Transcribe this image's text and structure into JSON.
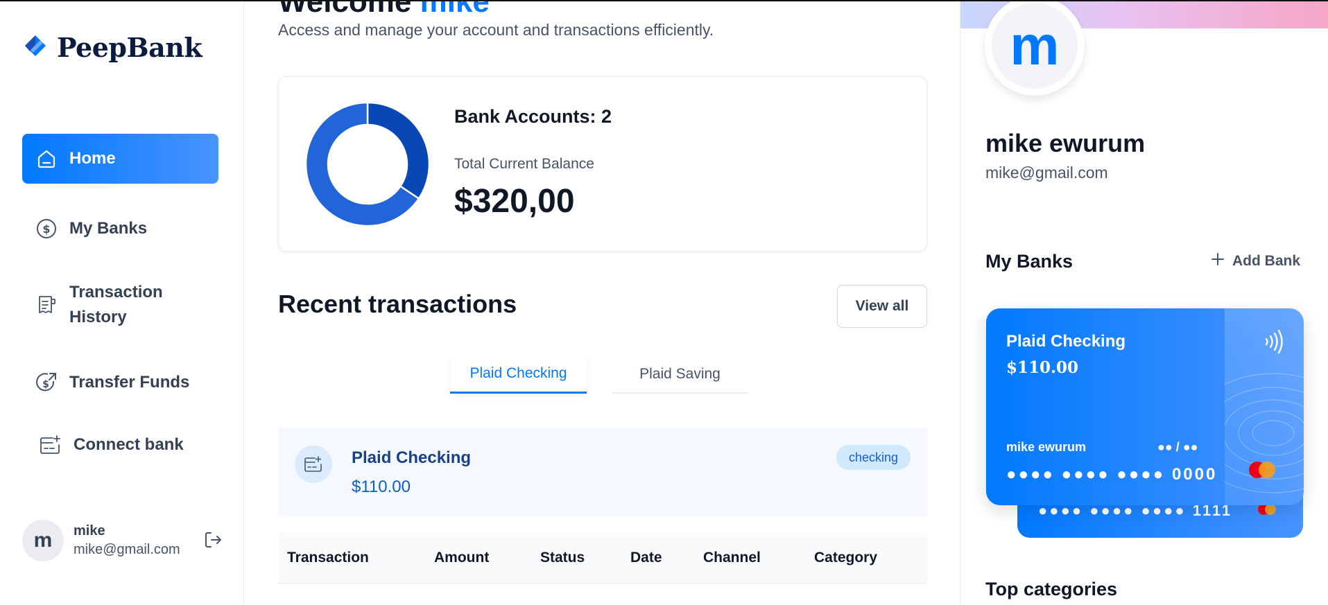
{
  "app": {
    "name": "PeepBank"
  },
  "sidebar": {
    "items": [
      {
        "label": "Home",
        "icon": "home-icon",
        "active": true
      },
      {
        "label": "My Banks",
        "icon": "dollar-circle-icon"
      },
      {
        "label_line1": "Transaction",
        "label_line2": "History",
        "icon": "receipt-icon"
      },
      {
        "label": "Transfer Funds",
        "icon": "money-send-icon"
      },
      {
        "label": "Connect bank",
        "icon": "connect-bank-icon"
      }
    ],
    "user": {
      "initial": "m",
      "name": "mike",
      "email": "mike@gmail.com"
    }
  },
  "header": {
    "greeting": "Welcome",
    "user_name": "mike",
    "subtitle": "Access and manage your account and transactions efficiently."
  },
  "balance": {
    "accounts_label": "Bank Accounts: 2",
    "total_label": "Total Current Balance",
    "total_value": "$320,00",
    "donut_segments": [
      {
        "fraction": 0.344,
        "color": "#0747b6"
      },
      {
        "fraction": 0.656,
        "color": "#2265d8"
      }
    ]
  },
  "recent": {
    "title": "Recent transactions",
    "view_all": "View all",
    "tabs": [
      {
        "label": "Plaid Checking",
        "active": true
      },
      {
        "label": "Plaid Saving",
        "active": false
      }
    ],
    "selected_bank": {
      "name": "Plaid Checking",
      "balance": "$110.00",
      "type": "checking"
    },
    "columns": [
      "Transaction",
      "Amount",
      "Status",
      "Date",
      "Channel",
      "Category"
    ]
  },
  "profile": {
    "initial": "m",
    "name": "mike ewurum",
    "email": "mike@gmail.com"
  },
  "my_banks": {
    "title": "My Banks",
    "add_label": "Add Bank",
    "cards": [
      {
        "name": "Plaid Checking",
        "balance": "$110.00",
        "holder": "mike ewurum",
        "expiry": "●● / ●●",
        "number": "●●●● ●●●● ●●●● 0000"
      },
      {
        "number": "●●●● ●●●● ●●●● 1111"
      }
    ]
  },
  "top_categories": {
    "title": "Top categories"
  },
  "colors": {
    "accent": "#0179fe",
    "text": "#101828",
    "muted": "#475467"
  }
}
